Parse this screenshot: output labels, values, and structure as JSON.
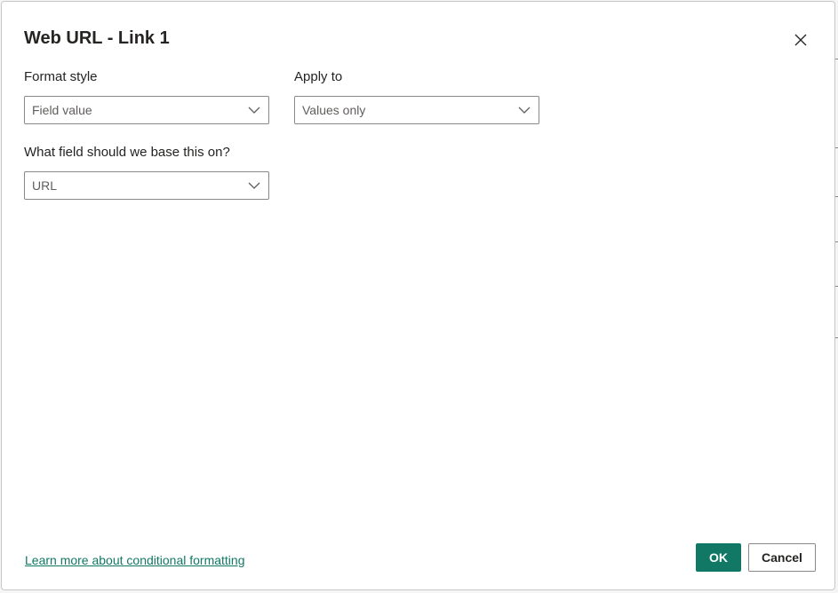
{
  "dialog": {
    "title": "Web URL - Link 1"
  },
  "format_style": {
    "label": "Format style",
    "selected": "Field value"
  },
  "apply_to": {
    "label": "Apply to",
    "selected": "Values only"
  },
  "base_field": {
    "label": "What field should we base this on?",
    "selected": "URL"
  },
  "footer": {
    "learn_more": "Learn more about conditional formatting",
    "ok_label": "OK",
    "cancel_label": "Cancel"
  },
  "icons": {
    "close": "close-icon",
    "dropdown": "chevron-down-icon"
  },
  "colors": {
    "accent": "#117865",
    "text": "#252423",
    "muted": "#605e5c",
    "border": "#8a8886"
  }
}
